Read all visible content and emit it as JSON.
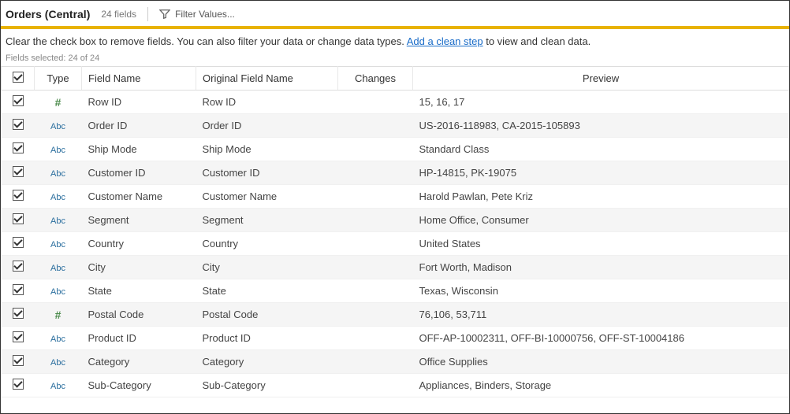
{
  "header": {
    "title": "Orders (Central)",
    "fields_count": "24 fields",
    "filter_label": "Filter Values..."
  },
  "hint": {
    "prefix": "Clear the check box to remove fields. You can also filter your data or change data types. ",
    "link": "Add a clean step",
    "suffix": " to view and clean data."
  },
  "fields_selected": "Fields selected: 24 of 24",
  "columns": {
    "type": "Type",
    "field_name": "Field Name",
    "original_field_name": "Original Field Name",
    "changes": "Changes",
    "preview": "Preview"
  },
  "type_labels": {
    "number": "#",
    "string": "Abc"
  },
  "rows": [
    {
      "checked": true,
      "type": "number",
      "field_name": "Row ID",
      "original": "Row ID",
      "changes": "",
      "preview": "15, 16, 17"
    },
    {
      "checked": true,
      "type": "string",
      "field_name": "Order ID",
      "original": "Order ID",
      "changes": "",
      "preview": "US-2016-118983, CA-2015-105893"
    },
    {
      "checked": true,
      "type": "string",
      "field_name": "Ship Mode",
      "original": "Ship Mode",
      "changes": "",
      "preview": "Standard Class"
    },
    {
      "checked": true,
      "type": "string",
      "field_name": "Customer ID",
      "original": "Customer ID",
      "changes": "",
      "preview": "HP-14815, PK-19075"
    },
    {
      "checked": true,
      "type": "string",
      "field_name": "Customer Name",
      "original": "Customer Name",
      "changes": "",
      "preview": "Harold Pawlan, Pete Kriz"
    },
    {
      "checked": true,
      "type": "string",
      "field_name": "Segment",
      "original": "Segment",
      "changes": "",
      "preview": "Home Office, Consumer"
    },
    {
      "checked": true,
      "type": "string",
      "field_name": "Country",
      "original": "Country",
      "changes": "",
      "preview": "United States"
    },
    {
      "checked": true,
      "type": "string",
      "field_name": "City",
      "original": "City",
      "changes": "",
      "preview": "Fort Worth, Madison"
    },
    {
      "checked": true,
      "type": "string",
      "field_name": "State",
      "original": "State",
      "changes": "",
      "preview": "Texas, Wisconsin"
    },
    {
      "checked": true,
      "type": "number",
      "field_name": "Postal Code",
      "original": "Postal Code",
      "changes": "",
      "preview": "76,106, 53,711"
    },
    {
      "checked": true,
      "type": "string",
      "field_name": "Product ID",
      "original": "Product ID",
      "changes": "",
      "preview": "OFF-AP-10002311, OFF-BI-10000756, OFF-ST-10004186"
    },
    {
      "checked": true,
      "type": "string",
      "field_name": "Category",
      "original": "Category",
      "changes": "",
      "preview": "Office Supplies"
    },
    {
      "checked": true,
      "type": "string",
      "field_name": "Sub-Category",
      "original": "Sub-Category",
      "changes": "",
      "preview": "Appliances, Binders, Storage"
    }
  ]
}
